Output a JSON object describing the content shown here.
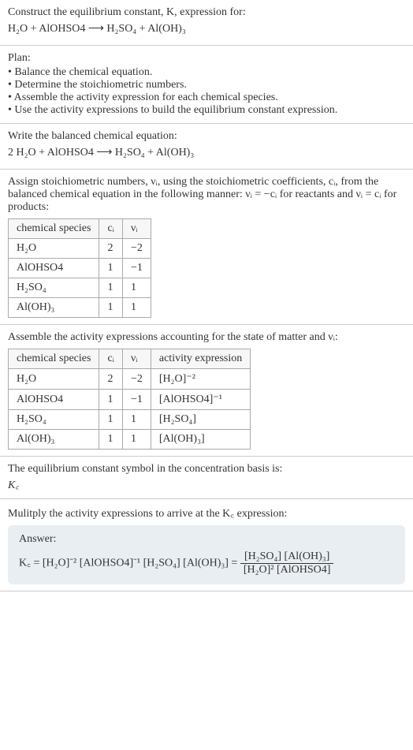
{
  "intro": {
    "line1": "Construct the equilibrium constant, K, expression for:",
    "equation": "H₂O + AlOHSO4 ⟶ H₂SO₄ + Al(OH)₃"
  },
  "plan": {
    "heading": "Plan:",
    "items": [
      "• Balance the chemical equation.",
      "• Determine the stoichiometric numbers.",
      "• Assemble the activity expression for each chemical species.",
      "• Use the activity expressions to build the equilibrium constant expression."
    ]
  },
  "balanced": {
    "heading": "Write the balanced chemical equation:",
    "equation": "2 H₂O + AlOHSO4 ⟶ H₂SO₄ + Al(OH)₃"
  },
  "stoich": {
    "text": "Assign stoichiometric numbers, νᵢ, using the stoichiometric coefficients, cᵢ, from the balanced chemical equation in the following manner: νᵢ = −cᵢ for reactants and νᵢ = cᵢ for products:",
    "headers": [
      "chemical species",
      "cᵢ",
      "νᵢ"
    ],
    "rows": [
      [
        "H₂O",
        "2",
        "−2"
      ],
      [
        "AlOHSO4",
        "1",
        "−1"
      ],
      [
        "H₂SO₄",
        "1",
        "1"
      ],
      [
        "Al(OH)₃",
        "1",
        "1"
      ]
    ]
  },
  "activity": {
    "text": "Assemble the activity expressions accounting for the state of matter and νᵢ:",
    "headers": [
      "chemical species",
      "cᵢ",
      "νᵢ",
      "activity expression"
    ],
    "rows": [
      [
        "H₂O",
        "2",
        "−2",
        "[H₂O]⁻²"
      ],
      [
        "AlOHSO4",
        "1",
        "−1",
        "[AlOHSO4]⁻¹"
      ],
      [
        "H₂SO₄",
        "1",
        "1",
        "[H₂SO₄]"
      ],
      [
        "Al(OH)₃",
        "1",
        "1",
        "[Al(OH)₃]"
      ]
    ]
  },
  "symbol": {
    "line1": "The equilibrium constant symbol in the concentration basis is:",
    "line2": "K꜀"
  },
  "multiply": {
    "text": "Mulitply the activity expressions to arrive at the K꜀ expression:"
  },
  "answer": {
    "label": "Answer:",
    "lhs": "K꜀ = [H₂O]⁻² [AlOHSO4]⁻¹ [H₂SO₄] [Al(OH)₃] = ",
    "frac_num": "[H₂SO₄] [Al(OH)₃]",
    "frac_den": "[H₂O]² [AlOHSO4]"
  }
}
